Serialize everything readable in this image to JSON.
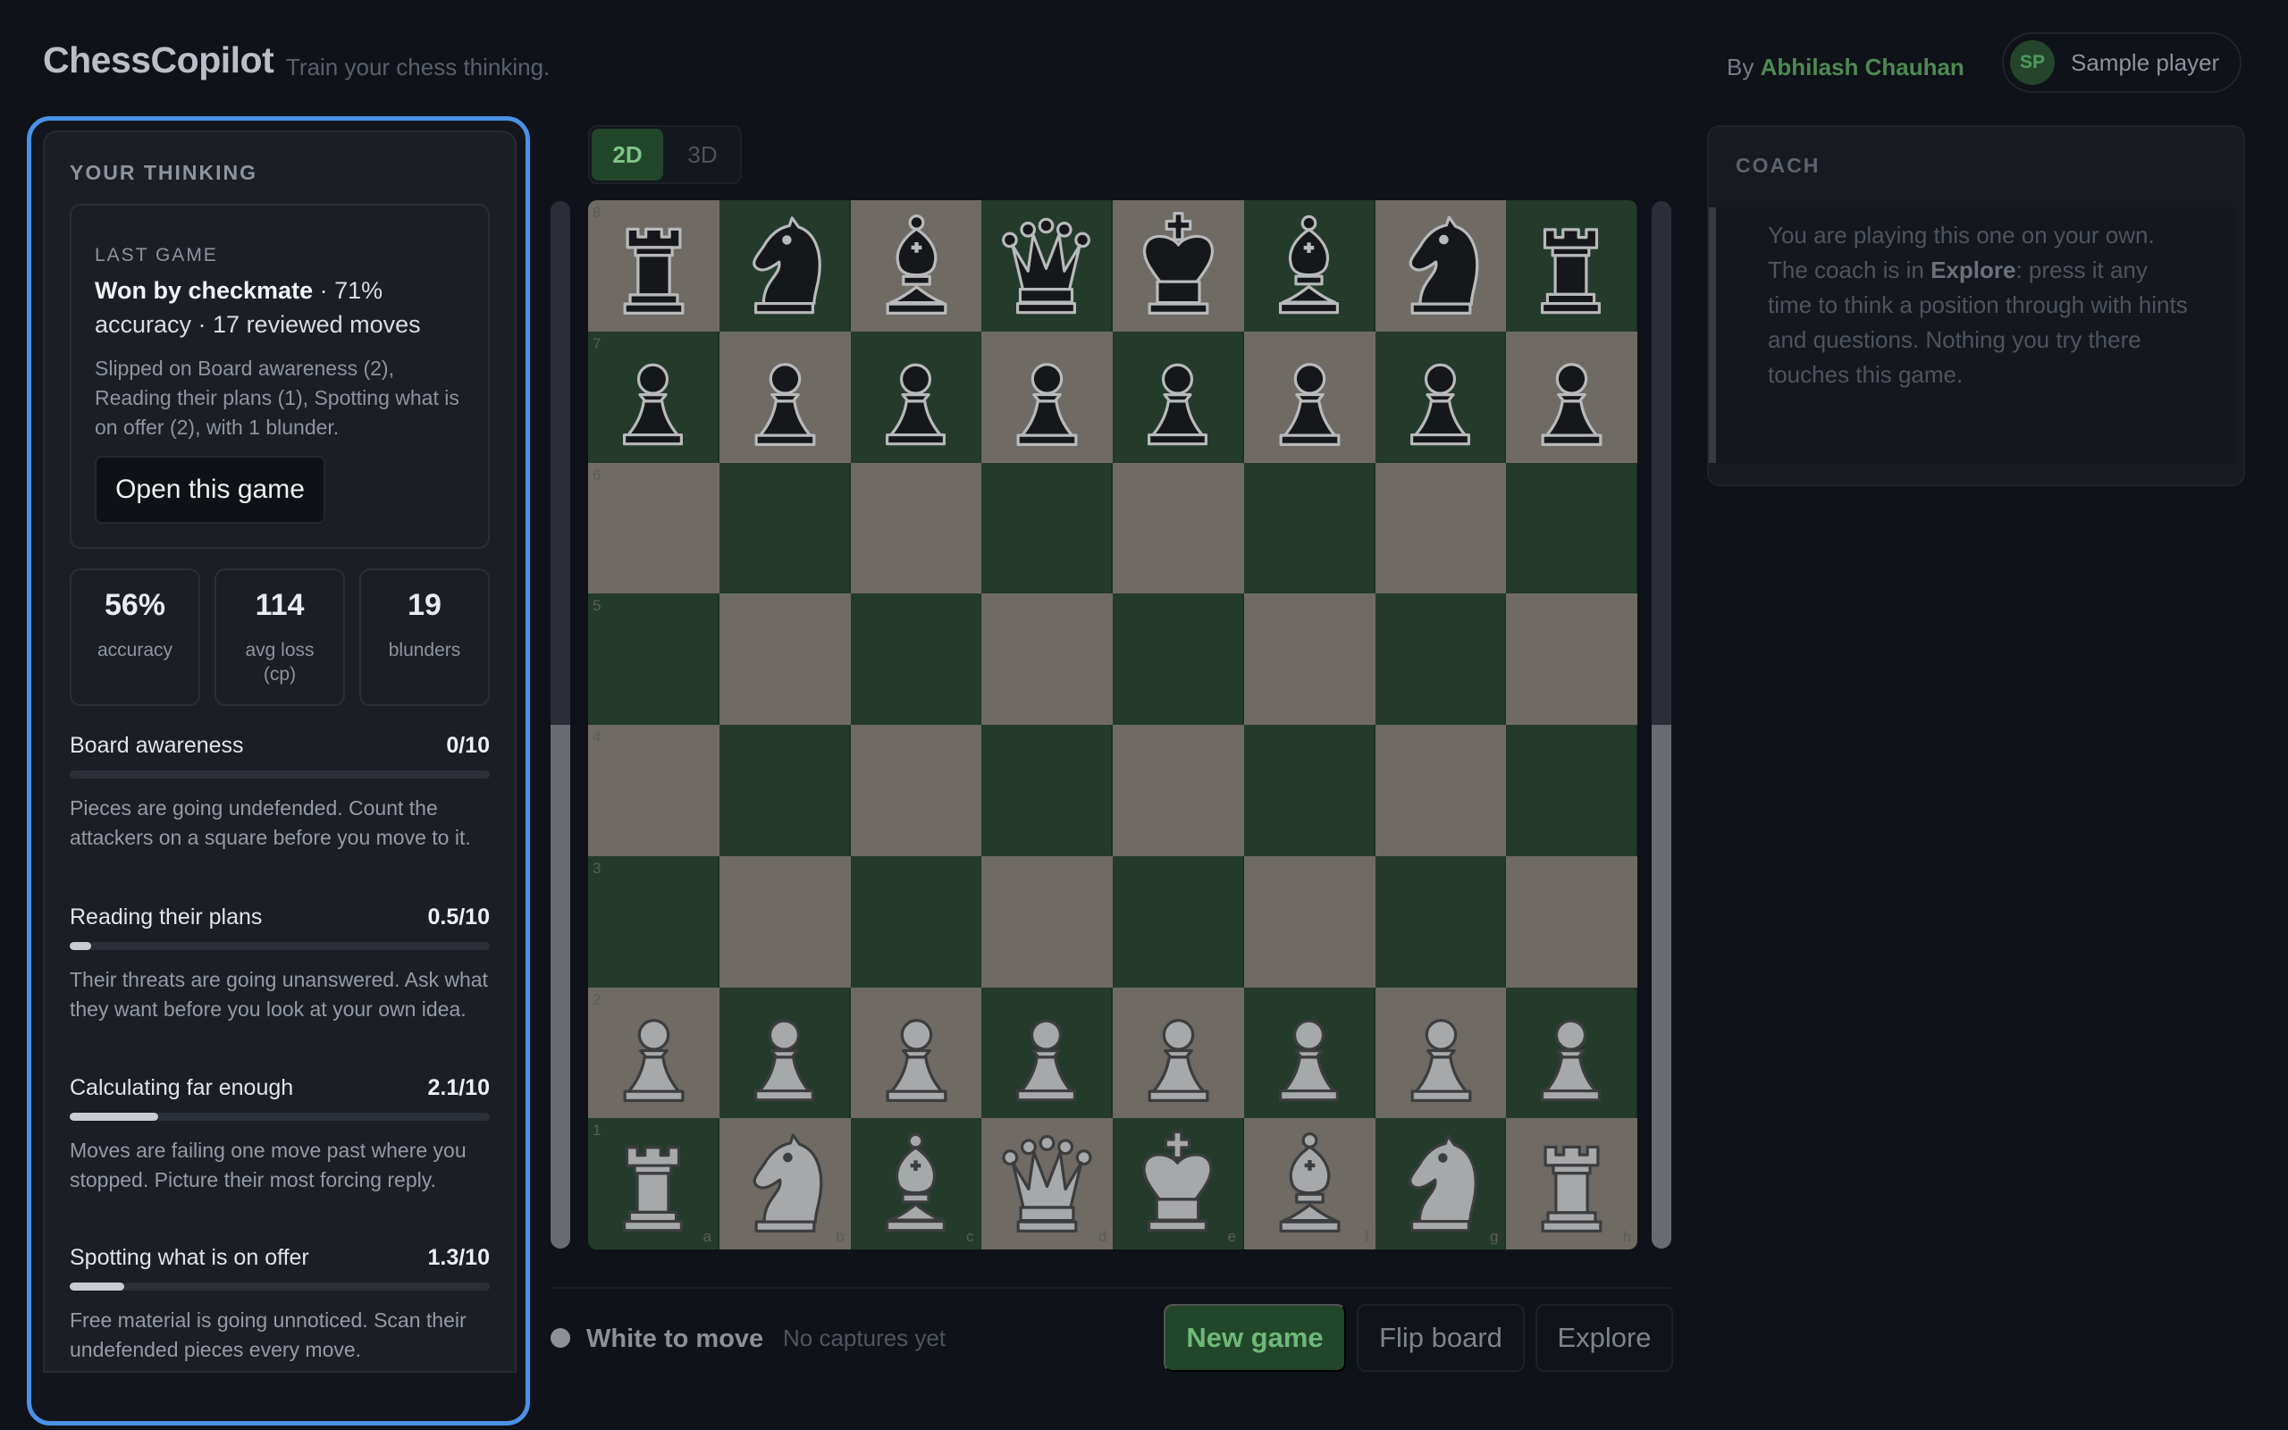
{
  "header": {
    "brand": "ChessCopilot",
    "tagline": "Train your chess thinking.",
    "by_prefix": "By",
    "author": "Abhilash Chauhan",
    "user_initials": "SP",
    "user_name": "Sample player"
  },
  "thinking": {
    "title": "YOUR THINKING",
    "last_game": {
      "label": "LAST GAME",
      "result": "Won by checkmate",
      "summary_rest": " · 71% accuracy · 17 reviewed moves",
      "detail": "Slipped on Board awareness (2), Reading their plans (1), Spotting what is on offer (2), with 1 blunder.",
      "open_button": "Open this game"
    },
    "stats": [
      {
        "value": "56%",
        "label": "accuracy"
      },
      {
        "value": "114",
        "label": "avg loss (cp)"
      },
      {
        "value": "19",
        "label": "blunders"
      }
    ],
    "skills": [
      {
        "name": "Board awareness",
        "score": "0/10",
        "level": 0.0,
        "advice": "Pieces are going undefended. Count the attackers on a square before you move to it."
      },
      {
        "name": "Reading their plans",
        "score": "0.5/10",
        "level": 0.05,
        "advice": "Their threats are going unanswered. Ask what they want before you look at your own idea."
      },
      {
        "name": "Calculating far enough",
        "score": "2.1/10",
        "level": 0.21,
        "advice": "Moves are failing one move past where you stopped. Picture their most forcing reply."
      },
      {
        "name": "Spotting what is on offer",
        "score": "1.3/10",
        "level": 0.13,
        "advice": "Free material is going unnoticed. Scan their undefended pieces every move."
      }
    ]
  },
  "board": {
    "view_options": [
      "2D",
      "3D"
    ],
    "active_view": "2D",
    "ranks": [
      "8",
      "7",
      "6",
      "5",
      "4",
      "3",
      "2",
      "1"
    ],
    "files": [
      "a",
      "b",
      "c",
      "d",
      "e",
      "f",
      "g",
      "h"
    ],
    "position": [
      [
        "br",
        "bn",
        "bb",
        "bq",
        "bk",
        "bb",
        "bn",
        "br"
      ],
      [
        "bp",
        "bp",
        "bp",
        "bp",
        "bp",
        "bp",
        "bp",
        "bp"
      ],
      [
        "",
        "",
        "",
        "",
        "",
        "",
        "",
        ""
      ],
      [
        "",
        "",
        "",
        "",
        "",
        "",
        "",
        ""
      ],
      [
        "",
        "",
        "",
        "",
        "",
        "",
        "",
        ""
      ],
      [
        "",
        "",
        "",
        "",
        "",
        "",
        "",
        ""
      ],
      [
        "wp",
        "wp",
        "wp",
        "wp",
        "wp",
        "wp",
        "wp",
        "wp"
      ],
      [
        "wr",
        "wn",
        "wb",
        "wq",
        "wk",
        "wb",
        "wn",
        "wr"
      ]
    ],
    "eval_white_share": 0.5
  },
  "status": {
    "turn": "White to move",
    "captures": "No captures yet"
  },
  "controls": {
    "new_game": "New game",
    "flip_board": "Flip board",
    "explore": "Explore"
  },
  "coach": {
    "title": "COACH",
    "text_before": "You are playing this one on your own. The coach is in ",
    "text_mode": "Explore",
    "text_after": ": press it any time to think a position through with hints and questions. Nothing you try there touches this game."
  },
  "colors": {
    "accent_focus": "#4a91e8",
    "accent_green": "#4c8a52",
    "board_light": "#6f6a63",
    "board_dark": "#243b2c"
  }
}
